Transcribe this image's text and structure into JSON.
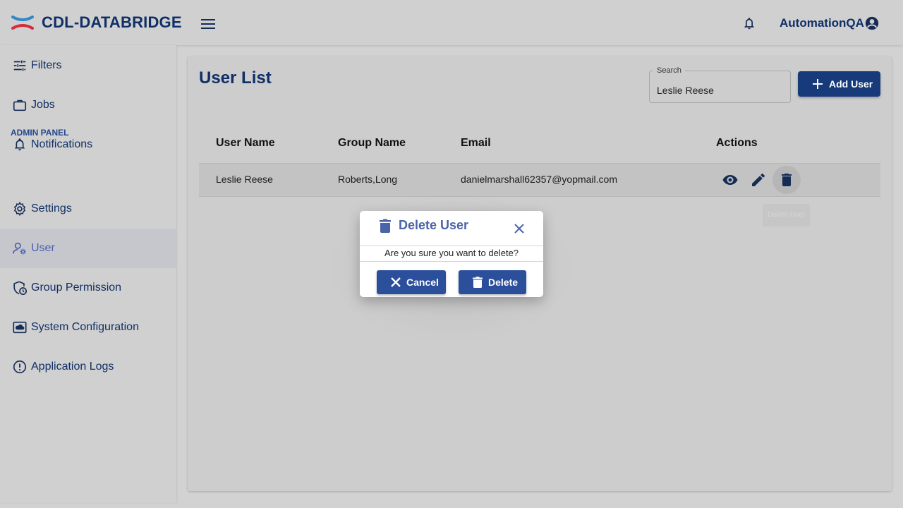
{
  "app": {
    "brand": "CDL-DATABRIDGE",
    "user": "AutomationQA"
  },
  "sidebar": {
    "items": [
      {
        "label": "Filters",
        "icon": "sliders-icon"
      },
      {
        "label": "Jobs",
        "icon": "briefcase-icon"
      },
      {
        "label": "Notifications",
        "icon": "bell-icon"
      }
    ],
    "admin_heading": "ADMIN PANEL",
    "admin_items": [
      {
        "label": "Settings",
        "icon": "gear-icon"
      },
      {
        "label": "User",
        "icon": "user-gear-icon",
        "active": true
      },
      {
        "label": "Group Permission",
        "icon": "shield-clock-icon"
      },
      {
        "label": "System Configuration",
        "icon": "cloud-screen-icon"
      },
      {
        "label": "Application Logs",
        "icon": "alert-circle-icon"
      }
    ]
  },
  "main": {
    "title": "User List",
    "search": {
      "label": "Search",
      "value": "Leslie Reese"
    },
    "add_button": "Add User",
    "table": {
      "headers": [
        "User Name",
        "Group Name",
        "Email",
        "Actions"
      ],
      "rows": [
        {
          "user_name": "Leslie Reese",
          "group_name": "Roberts,Long",
          "email": "danielmarshall62357@yopmail.com"
        }
      ]
    },
    "tooltip": "Delete User"
  },
  "dialog": {
    "title": "Delete User",
    "message": "Are you sure you want to delete?",
    "cancel": "Cancel",
    "delete": "Delete"
  },
  "colors": {
    "brand": "#0f2f66",
    "primary_button": "#163a7a",
    "dialog_button": "#2b4f9b",
    "logo_red": "#d62b3a",
    "logo_blue": "#2f86c8"
  }
}
